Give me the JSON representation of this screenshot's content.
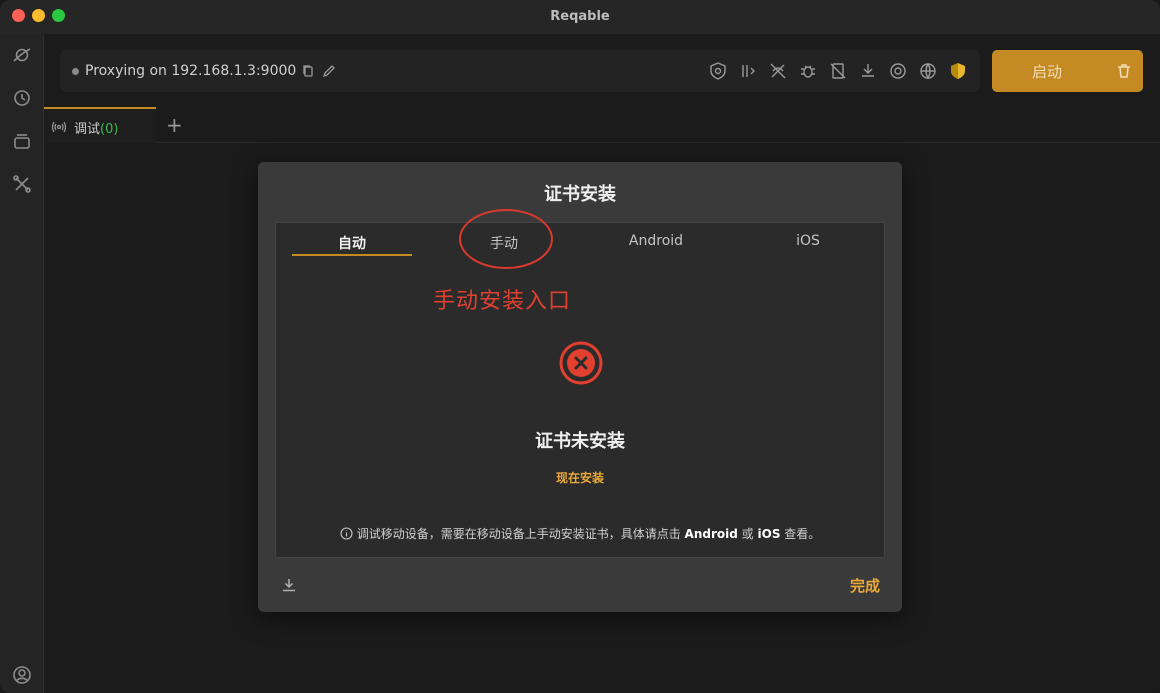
{
  "window": {
    "title": "Reqable"
  },
  "sidebar": {
    "items": [
      {
        "icon": "planet-icon"
      },
      {
        "icon": "history-icon"
      },
      {
        "icon": "collections-icon"
      },
      {
        "icon": "tools-icon"
      }
    ],
    "bottom_icon": "account-icon"
  },
  "toolbar": {
    "proxy_status": "Proxying on 192.168.1.3:9000",
    "start_label": "启动",
    "icons": [
      "shield-cert-icon",
      "breakpoint-icon",
      "rewrite-off-icon",
      "bug-icon",
      "script-off-icon",
      "download-icon",
      "record-icon",
      "network-icon",
      "security-shield-icon"
    ]
  },
  "tabs": [
    {
      "label": "调试",
      "count": "(0)"
    }
  ],
  "dialog": {
    "title": "证书安装",
    "tabs": [
      "自动",
      "手动",
      "Android",
      "iOS"
    ],
    "active_tab": "自动",
    "annotation": "手动安装入口",
    "status_title": "证书未安装",
    "install_link": "现在安装",
    "hint_prefix": "调试移动设备，需要在移动设备上手动安装证书，具体请点击",
    "hint_android": "Android",
    "hint_or": "或",
    "hint_ios": "iOS",
    "hint_suffix": "查看。",
    "done_label": "完成"
  },
  "colors": {
    "accent": "#c58a24",
    "link": "#e8a838",
    "error": "#e2402f",
    "count_green": "#3fb950"
  }
}
